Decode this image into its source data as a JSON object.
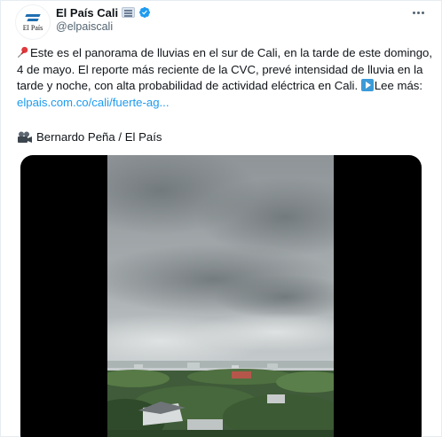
{
  "author": {
    "name": "El País Cali",
    "handle": "@elpaiscali",
    "avatar_text": "El País",
    "affiliate_badge_icon": "newspaper-badge-icon",
    "verified_icon": "verified-badge-icon",
    "verified_color": "#1d9bf0"
  },
  "tweet": {
    "text_main": "Este es el panorama de lluvias en el sur de Cali, en la tarde de este domingo, 4 de mayo. El reporte más reciente de la CVC, prevé intensidad de lluvia en la tarde y noche, con alta probabilidad de actividad eléctrica en Cali.",
    "read_more_label": "Lee más:",
    "link_text": "elpais.com.co/cali/fuerte-ag...",
    "credit": "Bernardo Peña / El País",
    "pin_icon": "pushpin-icon",
    "play_icon": "play-button-icon",
    "camera_icon": "movie-camera-icon",
    "link_color": "#1d9bf0"
  },
  "media": {
    "type": "video",
    "content_icon": "video-thumbnail-rainy-sky"
  }
}
